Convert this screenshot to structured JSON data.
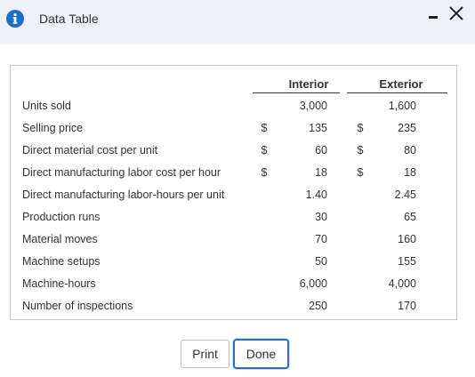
{
  "dialog": {
    "title": "Data Table",
    "info_icon": "info-icon",
    "minimize_icon": "minimize-icon",
    "close_icon": "close-icon"
  },
  "table": {
    "columns": [
      "Interior",
      "Exterior"
    ],
    "rows": [
      {
        "label": "Units sold",
        "interior": "3,000",
        "exterior": "1,600",
        "dollar_interior": "",
        "dollar_exterior": ""
      },
      {
        "label": "Selling price",
        "interior": "135",
        "exterior": "235",
        "dollar_interior": "$",
        "dollar_exterior": "$"
      },
      {
        "label": "Direct material cost per unit",
        "interior": "60",
        "exterior": "80",
        "dollar_interior": "$",
        "dollar_exterior": "$"
      },
      {
        "label": "Direct manufacturing labor cost per hour",
        "interior": "18",
        "exterior": "18",
        "dollar_interior": "$",
        "dollar_exterior": "$"
      },
      {
        "label": "Direct manufacturing labor-hours per unit",
        "interior": "1.40",
        "exterior": "2.45",
        "dollar_interior": "",
        "dollar_exterior": ""
      },
      {
        "label": "Production runs",
        "interior": "30",
        "exterior": "65",
        "dollar_interior": "",
        "dollar_exterior": ""
      },
      {
        "label": "Material moves",
        "interior": "70",
        "exterior": "160",
        "dollar_interior": "",
        "dollar_exterior": ""
      },
      {
        "label": "Machine setups",
        "interior": "50",
        "exterior": "155",
        "dollar_interior": "",
        "dollar_exterior": ""
      },
      {
        "label": "Machine-hours",
        "interior": "6,000",
        "exterior": "4,000",
        "dollar_interior": "",
        "dollar_exterior": ""
      },
      {
        "label": "Number of inspections",
        "interior": "250",
        "exterior": "170",
        "dollar_interior": "",
        "dollar_exterior": ""
      }
    ]
  },
  "buttons": {
    "print": "Print",
    "done": "Done"
  }
}
